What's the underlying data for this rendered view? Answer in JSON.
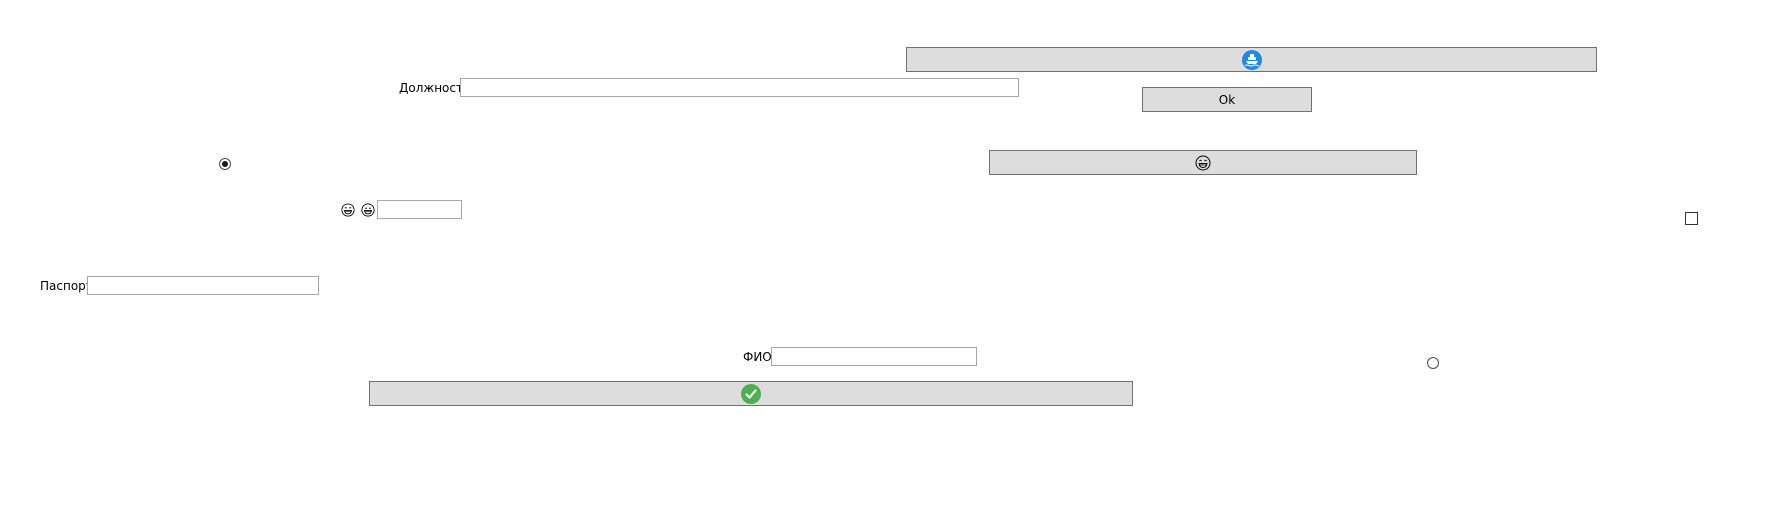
{
  "form": {
    "position_label": "Должность",
    "position_value": "",
    "passport_label": "Паспорт",
    "passport_value": "",
    "fio_label": "ФИО",
    "fio_value": "",
    "small_field_value": "",
    "ok_button_label": "Ok"
  },
  "icons": {
    "top_button_icon": "ship-icon",
    "middle_button_icon": "grinning-face-icon",
    "bottom_button_icon": "green-check-icon",
    "inline_icon_1": "laughing-face-icon",
    "inline_icon_2": "grinning-face-icon"
  },
  "controls": {
    "radio_1_checked": true,
    "radio_2_checked": false,
    "checkbox_checked": false
  },
  "colors": {
    "button_bg": "#dddddd",
    "ship_icon_bg": "#1e88e5",
    "check_icon_bg": "#4caf50"
  }
}
